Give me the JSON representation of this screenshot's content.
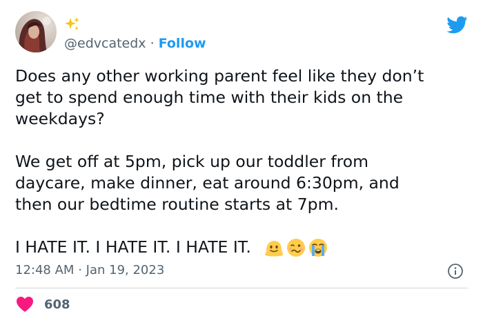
{
  "author": {
    "handle": "@edvcatedx",
    "separator": "·",
    "follow_label": "Follow"
  },
  "tweet": {
    "paragraphs": [
      "Does any other working parent feel like they don’t|get to spend enough time with their kids on the|weekdays?",
      "We get off at 5pm, pick up our toddler from|daycare, make dinner, eat around 6:30pm, and|then our bedtime routine starts at 7pm."
    ],
    "para1_lines": [
      "Does any other working parent feel like they don’t",
      "get to spend enough time with their kids on the",
      "weekdays?"
    ],
    "para2_lines": [
      "We get off at 5pm, pick up our toddler from",
      "daycare, make dinner, eat around 6:30pm, and",
      "then our bedtime routine starts at 7pm."
    ],
    "para3_text": "I HATE IT. I HATE IT. I HATE IT.",
    "emojis": [
      "melting-face-emoji",
      "woozy-face-emoji",
      "loudly-crying-face-emoji"
    ]
  },
  "meta": {
    "time": "12:48 AM",
    "separator": "·",
    "date": "Jan 19, 2023"
  },
  "engagement": {
    "like_count": "608"
  },
  "colors": {
    "accent": "#1d9bf0",
    "secondary_text": "#536471",
    "like": "#f91880",
    "divider": "#cfd9de"
  }
}
